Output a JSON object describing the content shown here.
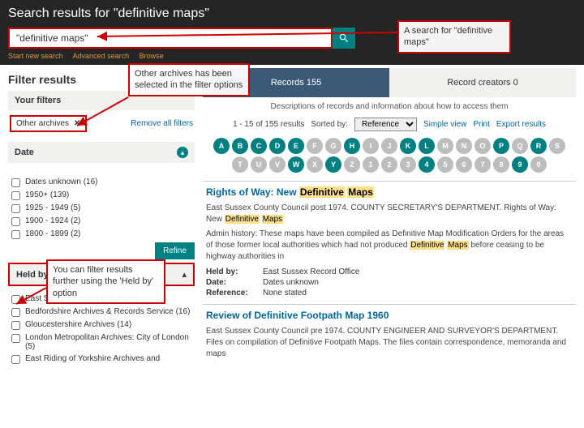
{
  "header": {
    "title": "Search results for \"definitive maps\"",
    "search_value": "\"definitive maps\"",
    "links": {
      "new_search": "Start new search",
      "advanced": "Advanced search",
      "browse": "Browse"
    }
  },
  "annotations": {
    "search_for": "A search for \"definitive maps\"",
    "other_archives": "Other archives has been selected in the filter options",
    "heldby": "You can filter results further using the 'Held by' option"
  },
  "sidebar": {
    "title": "Filter results",
    "your_filters_label": "Your filters",
    "chip": "Other archives",
    "remove_all": "Remove all filters",
    "date": {
      "label": "Date",
      "options": [
        {
          "label": "Dates unknown (16)"
        },
        {
          "label": "1950+ (139)"
        },
        {
          "label": "1925 - 1949 (5)"
        },
        {
          "label": "1900 - 1924 (2)"
        },
        {
          "label": "1800 - 1899 (2)"
        }
      ]
    },
    "refine": "Refine",
    "heldby": {
      "label": "Held by",
      "options": [
        {
          "label": "East Sussex Record Office (98)"
        },
        {
          "label": "Bedfordshire Archives & Records Service (16)"
        },
        {
          "label": "Gloucestershire Archives (14)"
        },
        {
          "label": "London Metropolitan Archives: City of London (5)"
        },
        {
          "label": "East Riding of Yorkshire Archives and"
        }
      ]
    }
  },
  "main": {
    "tabs": {
      "records": "Records 155",
      "creators": "Record creators 0"
    },
    "description": "Descriptions of records and information about how to access them",
    "sort": {
      "range": "1 - 15 of 155 results",
      "sorted_by_label": "Sorted by:",
      "sorted_by_value": "Reference",
      "simple_view": "Simple view",
      "print": "Print",
      "export": "Export results"
    },
    "alpha": [
      {
        "l": "A",
        "on": true
      },
      {
        "l": "B",
        "on": true
      },
      {
        "l": "C",
        "on": true
      },
      {
        "l": "D",
        "on": true
      },
      {
        "l": "E",
        "on": true
      },
      {
        "l": "F",
        "on": false
      },
      {
        "l": "G",
        "on": false
      },
      {
        "l": "H",
        "on": true
      },
      {
        "l": "I",
        "on": false
      },
      {
        "l": "J",
        "on": false
      },
      {
        "l": "K",
        "on": true
      },
      {
        "l": "L",
        "on": true
      },
      {
        "l": "M",
        "on": false
      },
      {
        "l": "N",
        "on": false
      },
      {
        "l": "O",
        "on": false
      },
      {
        "l": "P",
        "on": true
      },
      {
        "l": "Q",
        "on": false
      },
      {
        "l": "R",
        "on": true
      },
      {
        "l": "S",
        "on": false
      },
      {
        "l": "T",
        "on": false
      },
      {
        "l": "U",
        "on": false
      },
      {
        "l": "V",
        "on": false
      },
      {
        "l": "W",
        "on": true
      },
      {
        "l": "X",
        "on": false
      },
      {
        "l": "Y",
        "on": true
      },
      {
        "l": "Z",
        "on": false
      },
      {
        "l": "1",
        "on": false
      },
      {
        "l": "2",
        "on": false
      },
      {
        "l": "3",
        "on": false
      },
      {
        "l": "4",
        "on": true
      },
      {
        "l": "5",
        "on": false
      },
      {
        "l": "6",
        "on": false
      },
      {
        "l": "7",
        "on": false
      },
      {
        "l": "8",
        "on": false
      },
      {
        "l": "9",
        "on": true
      },
      {
        "l": "0",
        "on": false
      }
    ],
    "results": [
      {
        "title_pre": "Rights of Way: New ",
        "title_hl1": "Definitive",
        "title_mid": " ",
        "title_hl2": "Maps",
        "context_pre": "East Sussex County Council post 1974. COUNTY SECRETARY'S DEPARTMENT. Rights of Way: New ",
        "context_hl1": "Definitive",
        "context_mid": " ",
        "context_hl2": "Maps",
        "admin_pre": "Admin history: These maps have been compiled as Definitive Map Modification Orders for the areas of those former local authorities which had not produced ",
        "admin_hl1": "Definitive",
        "admin_mid": " ",
        "admin_hl2": "Maps",
        "admin_post": " before ceasing to be highway authorities in",
        "heldby": "East Sussex Record Office",
        "date": "Dates unknown",
        "reference": "None stated"
      },
      {
        "title2": "Review of Definitive Footpath Map 1960",
        "context2": "East Sussex County Council pre 1974. COUNTY ENGINEER AND SURVEYOR'S DEPARTMENT. Files on compilation of Definitive Footpath Maps. The files contain correspondence, memoranda and maps"
      }
    ],
    "meta_labels": {
      "heldby": "Held by:",
      "date": "Date:",
      "reference": "Reference:"
    }
  }
}
